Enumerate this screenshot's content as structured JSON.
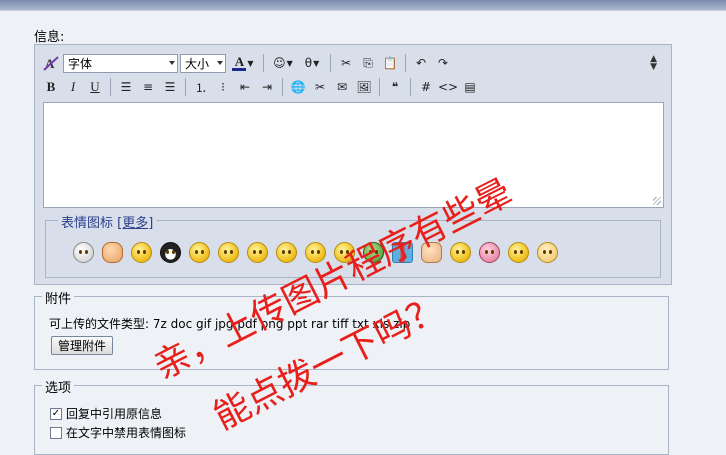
{
  "info_label": "信息:",
  "toolbar": {
    "font_combo": "字体",
    "size_combo": "大小",
    "font_color_glyph": "A",
    "bold": "B",
    "italic": "I",
    "underline": "U"
  },
  "emoticons": {
    "legend": "表情图标",
    "more_link": "[更多]",
    "icons": [
      "skull-icon",
      "fist-icon",
      "smile-icon",
      "penguin-icon",
      "smirk-icon",
      "angry-icon",
      "shy-icon",
      "grin-icon",
      "eat-icon",
      "wink-icon",
      "green-face-icon",
      "gift-icon",
      "victory-icon",
      "blush-icon",
      "couple-icon",
      "happy-icon",
      "sad-icon"
    ]
  },
  "attachments": {
    "legend": "附件",
    "file_types": "可上传的文件类型: 7z doc gif jpg pdf png ppt rar tiff txt xls zip",
    "manage_button": "管理附件"
  },
  "options": {
    "legend": "选项",
    "quote_label": "回复中引用原信息",
    "quote_checked": true,
    "disable_smilies_label": "在文字中禁用表情图标",
    "disable_smilies_checked": false
  },
  "overlay_text": {
    "line1": "亲，上传图片程序有些晕",
    "line2": "能点拨一下吗？",
    "color": "#e8201c"
  }
}
